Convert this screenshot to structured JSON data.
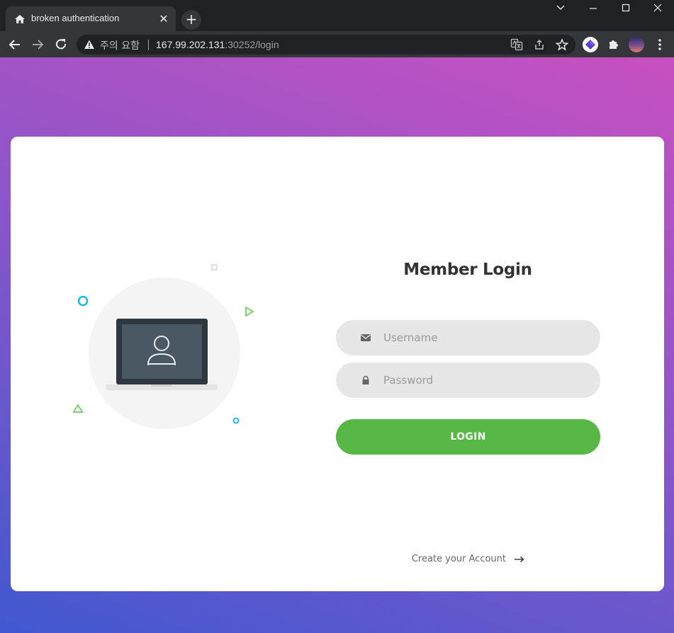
{
  "browser": {
    "tab": {
      "title": "broken authentication",
      "close_glyph": "✕",
      "favicon": "home-icon"
    },
    "new_tab_glyph": "+",
    "window_controls": {
      "tablist": "⌄",
      "minimize": "—",
      "maximize": "☐",
      "close": "✕"
    },
    "omnibox": {
      "security_label": "주의 요함",
      "url_host": "167.99.202.131",
      "url_rest": ":30252/login"
    },
    "icons": [
      "back-icon",
      "forward-icon",
      "reload-icon",
      "warning-icon",
      "translate-icon",
      "share-icon",
      "star-icon",
      "extension-icon",
      "puzzle-icon",
      "profile-avatar",
      "more-icon"
    ]
  },
  "page": {
    "title": "Member Login",
    "username": {
      "placeholder": "Username",
      "value": ""
    },
    "password": {
      "placeholder": "Password",
      "value": ""
    },
    "login_label": "LOGIN",
    "create_account_label": "Create your Account",
    "colors": {
      "accent_green": "#57b846",
      "gradient_start": "#c850c0",
      "gradient_end": "#4158d0",
      "field_bg": "#e6e6e6",
      "title": "#333333"
    }
  }
}
